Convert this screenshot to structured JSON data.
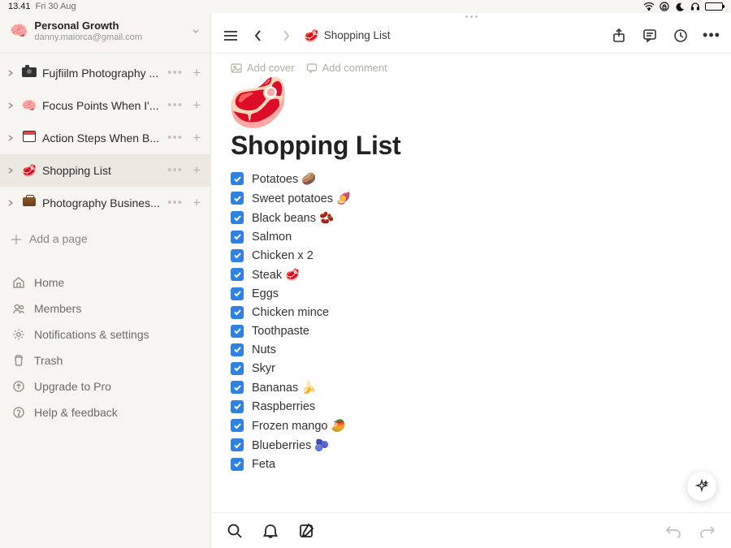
{
  "status_bar": {
    "time": "13.41",
    "date": "Fri 30 Aug"
  },
  "workspace": {
    "icon": "🧠",
    "title": "Personal Growth",
    "subtitle": "danny.maiorca@gmail.com"
  },
  "sidebar_pages": [
    {
      "emoji_kind": "camera",
      "label": "Fujfiilm Photography ...",
      "selected": false
    },
    {
      "emoji_kind": "brain",
      "label": "Focus Points When I'...",
      "selected": false
    },
    {
      "emoji_kind": "calendar",
      "label": "Action Steps When B...",
      "selected": false
    },
    {
      "emoji_kind": "meat",
      "label": "Shopping List",
      "selected": true
    },
    {
      "emoji_kind": "briefcase",
      "label": "Photography Busines...",
      "selected": false
    }
  ],
  "add_page_label": "Add a page",
  "nav_items": [
    {
      "icon": "home",
      "label": "Home"
    },
    {
      "icon": "members",
      "label": "Members"
    },
    {
      "icon": "settings",
      "label": "Notifications & settings"
    },
    {
      "icon": "trash",
      "label": "Trash"
    },
    {
      "icon": "upgrade",
      "label": "Upgrade to Pro"
    },
    {
      "icon": "help",
      "label": "Help & feedback"
    }
  ],
  "breadcrumb": {
    "icon": "🥩",
    "label": "Shopping List"
  },
  "doc": {
    "add_cover": "Add cover",
    "add_comment": "Add comment",
    "big_emoji": "🥩",
    "title": "Shopping List",
    "todos": [
      {
        "checked": true,
        "text": "Potatoes 🥔"
      },
      {
        "checked": true,
        "text": "Sweet potatoes 🍠"
      },
      {
        "checked": true,
        "text": "Black beans 🫘"
      },
      {
        "checked": true,
        "text": "Salmon"
      },
      {
        "checked": true,
        "text": "Chicken x 2"
      },
      {
        "checked": true,
        "text": "Steak 🥩"
      },
      {
        "checked": true,
        "text": "Eggs"
      },
      {
        "checked": true,
        "text": "Chicken mince"
      },
      {
        "checked": true,
        "text": "Toothpaste"
      },
      {
        "checked": true,
        "text": "Nuts"
      },
      {
        "checked": true,
        "text": "Skyr"
      },
      {
        "checked": true,
        "text": "Bananas 🍌"
      },
      {
        "checked": true,
        "text": "Raspberries"
      },
      {
        "checked": true,
        "text": "Frozen mango 🥭"
      },
      {
        "checked": true,
        "text": "Blueberries 🫐"
      },
      {
        "checked": true,
        "text": "Feta"
      }
    ]
  }
}
